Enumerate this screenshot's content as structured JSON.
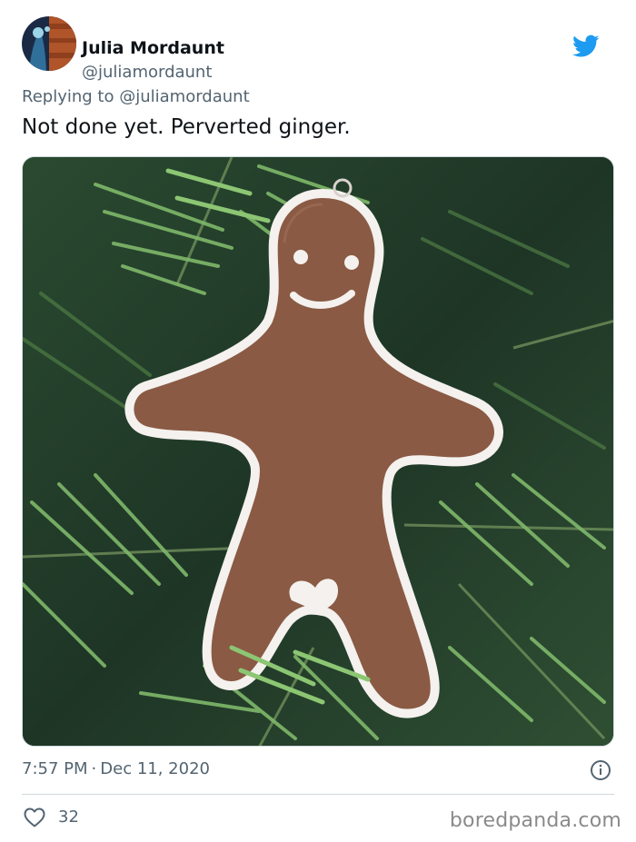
{
  "tweet": {
    "display_name": "Julia Mordaunt",
    "handle": "@juliamordaunt",
    "reply_prefix": "Replying to",
    "reply_to": "@juliamordaunt",
    "text": "Not done yet. Perverted ginger.",
    "time": "7:57 PM",
    "separator": "·",
    "date": "Dec 11, 2020",
    "likes": "32"
  },
  "media": {
    "type": "photo",
    "subject": "gingerbread-man-ornament-on-fir-tree"
  },
  "icons": {
    "brand": "twitter-bird-icon",
    "info": "info-icon",
    "like": "heart-icon"
  },
  "colors": {
    "twitter_blue": "#1d9bf0",
    "secondary_text": "#536471",
    "primary_text": "#0f1419",
    "ginger_brown": "#8a5a44",
    "icing_white": "#f4f1ee",
    "fir_green": "#3c6e3a"
  },
  "watermark": "boredpanda.com"
}
